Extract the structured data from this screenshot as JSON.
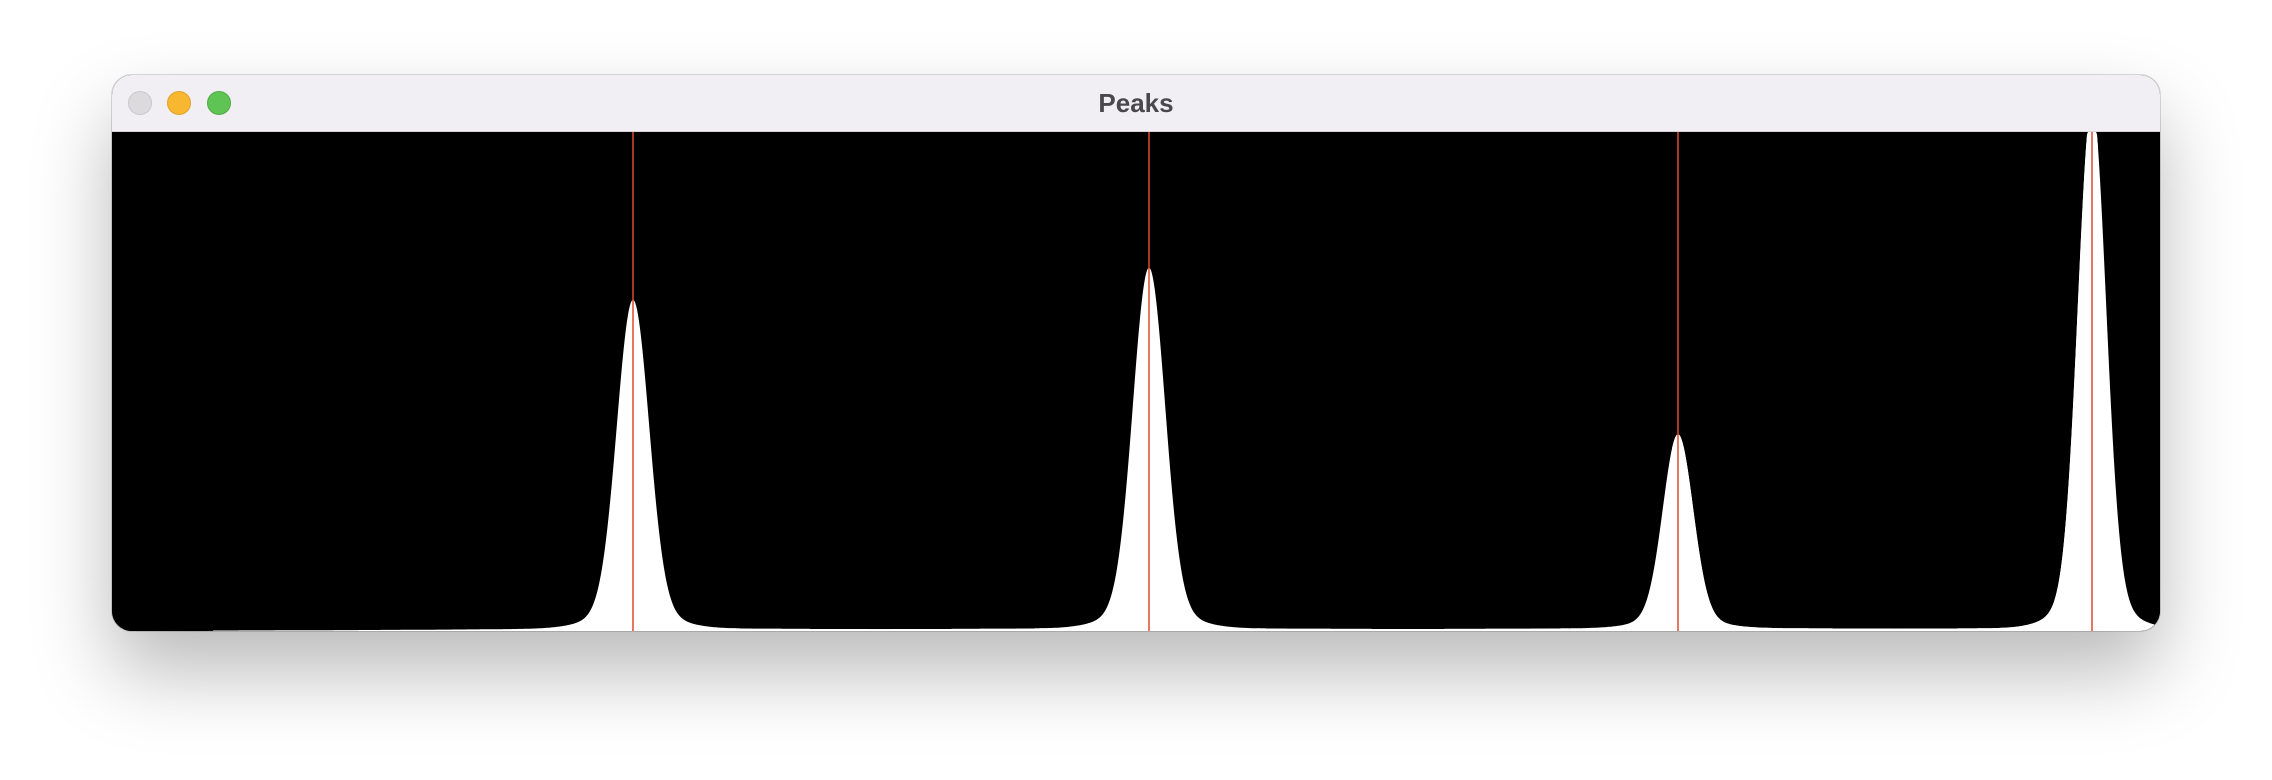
{
  "window": {
    "title": "Peaks",
    "buttons": [
      "close",
      "minimize",
      "zoom"
    ]
  },
  "colors": {
    "background": "#000000",
    "fill": "#ffffff",
    "marker": "#e04a2f",
    "titlebar": "#f1eff3",
    "close": "#dcdadd",
    "minimize": "#f7b731",
    "zoom": "#5fc453"
  },
  "chart_data": {
    "type": "area",
    "xlim": [
      0,
      2048
    ],
    "ylim": [
      0,
      1
    ],
    "peaks": [
      {
        "center": 521,
        "amplitude": 0.62,
        "width": 16
      },
      {
        "center": 1037,
        "amplitude": 0.68,
        "width": 16
      },
      {
        "center": 1566,
        "amplitude": 0.365,
        "width": 15
      },
      {
        "center": 1980,
        "amplitude": 0.99,
        "width": 14
      }
    ],
    "markers": [
      521,
      1037,
      1566,
      1980
    ],
    "grid": false,
    "legend": "none"
  }
}
